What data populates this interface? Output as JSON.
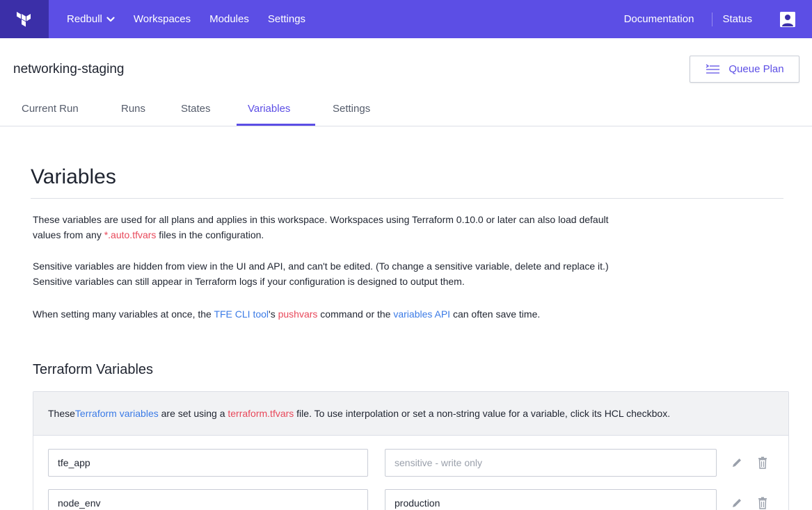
{
  "topnav": {
    "org": "Redbull",
    "items": [
      "Workspaces",
      "Modules",
      "Settings"
    ],
    "right": [
      "Documentation",
      "Status"
    ]
  },
  "workspace": {
    "name": "networking-staging",
    "queue_label": "Queue Plan"
  },
  "tabs": [
    "Current Run",
    "Runs",
    "States",
    "Variables",
    "Settings"
  ],
  "active_tab": "Variables",
  "content": {
    "title": "Variables",
    "p1": {
      "a": "These variables are used for all plans and applies in this workspace. Workspaces using Terraform 0.10.0 or later can also load default",
      "b": "values from any ",
      "code": "*.auto.tfvars",
      "c": " files in the configuration."
    },
    "p2": {
      "line1": "Sensitive variables are hidden from view in the UI and API, and can't be edited. (To change a sensitive variable, delete and replace it.)",
      "line2": "Sensitive variables can still appear in Terraform logs if your configuration is designed to output them."
    },
    "p3": {
      "a": "When setting many variables at once, the ",
      "link1": "TFE CLI tool",
      "b": "'s ",
      "code": "pushvars",
      "c": " command or the ",
      "link2": "variables API",
      "d": " can often save time."
    },
    "section_title": "Terraform Variables",
    "panel_note": {
      "a": "These ",
      "link": "Terraform variables",
      "b": " are set using a ",
      "code": "terraform.tfvars",
      "c": " file. To use interpolation or set a non-string value for a variable, click its HCL checkbox."
    }
  },
  "variables": [
    {
      "key": "tfe_app",
      "value": "",
      "value_placeholder": "sensitive - write only"
    },
    {
      "key": "node_env",
      "value": "production",
      "value_placeholder": ""
    }
  ],
  "colors": {
    "nav": "#5c4ee5",
    "nav_logo_bg": "#3b2fa8",
    "accent": "#5c4ee5",
    "link": "#3b7be6",
    "code": "#e8485a"
  }
}
